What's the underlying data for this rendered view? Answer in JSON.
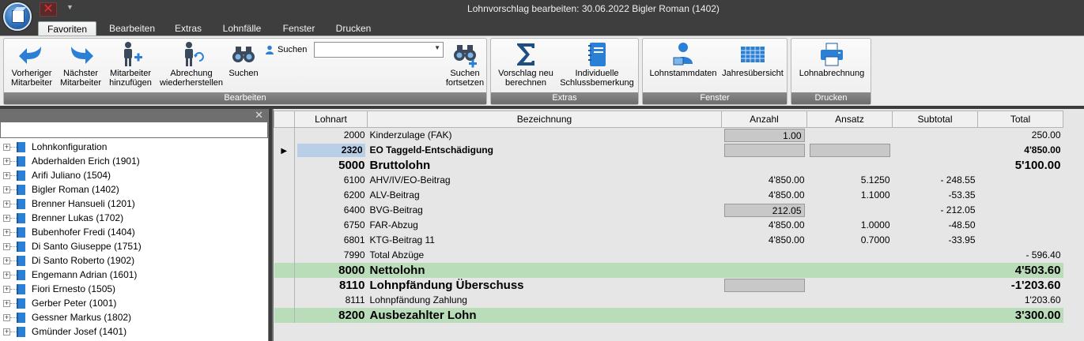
{
  "window": {
    "title": "Lohnvorschlag bearbeiten: 30.06.2022 Bigler Roman (1402)"
  },
  "quick_access": {
    "close_glyph": "✕",
    "dropdown_glyph": "▼"
  },
  "tabs": [
    {
      "label": "Favoriten",
      "active": true
    },
    {
      "label": "Bearbeiten",
      "active": false
    },
    {
      "label": "Extras",
      "active": false
    },
    {
      "label": "Lohnfälle",
      "active": false
    },
    {
      "label": "Fenster",
      "active": false
    },
    {
      "label": "Drucken",
      "active": false
    }
  ],
  "ribbon": {
    "groups": {
      "bearbeiten": {
        "label": "Bearbeiten",
        "buttons": {
          "prev": {
            "line1": "Vorheriger",
            "line2": "Mitarbeiter"
          },
          "next": {
            "line1": "Nächster",
            "line2": "Mitarbeiter"
          },
          "add": {
            "line1": "Mitarbeiter",
            "line2": "hinzufügen"
          },
          "restore": {
            "line1": "Abrechung",
            "line2": "wiederherstellen"
          },
          "search": {
            "line1": "Suchen",
            "line2": ""
          },
          "continue": {
            "line1": "Suchen",
            "line2": "fortsetzen"
          }
        },
        "search_label": "Suchen",
        "search_value": ""
      },
      "extras": {
        "label": "Extras",
        "buttons": {
          "recalc": {
            "line1": "Vorschlag neu",
            "line2": "berechnen"
          },
          "remark": {
            "line1": "Individuelle",
            "line2": "Schlussbemerkung"
          }
        }
      },
      "fenster": {
        "label": "Fenster",
        "buttons": {
          "master": {
            "line1": "Lohnstammdaten",
            "line2": ""
          },
          "yearly": {
            "line1": "Jahresübersicht",
            "line2": ""
          }
        }
      },
      "drucken": {
        "label": "Drucken",
        "buttons": {
          "payslip": {
            "line1": "Lohnabrechnung",
            "line2": ""
          }
        }
      }
    }
  },
  "colors": {
    "accent_blue": "#2b80d6",
    "green_row": "#b9ddb9",
    "selected_cell": "#b9cfe8"
  },
  "left_panel": {
    "close_glyph": "✕",
    "filter_value": "",
    "items": [
      "Lohnkonfiguration",
      "Abderhalden Erich (1901)",
      "Arifi Juliano (1504)",
      "Bigler Roman (1402)",
      "Brenner Hansueli (1201)",
      "Brenner Lukas (1702)",
      "Bubenhofer Fredi (1404)",
      "Di Santo Giuseppe (1751)",
      "Di Santo Roberto (1902)",
      "Engemann Adrian (1601)",
      "Fiori Ernesto (1505)",
      "Gerber Peter (1001)",
      "Gessner Markus (1802)",
      "Gmünder Josef (1401)"
    ]
  },
  "grid": {
    "columns": [
      "Lohnart",
      "Bezeichnung",
      "Anzahl",
      "Ansatz",
      "Subtotal",
      "Total"
    ],
    "current_row_marker": "▶",
    "rows": [
      {
        "lohnart": "2000",
        "bezeichnung": "Kinderzulage (FAK)",
        "anzahl": "1.00",
        "ansatz": "",
        "subtotal": "",
        "total": "250.00",
        "style": "normal",
        "anzahl_box": true,
        "ansatz_box": false
      },
      {
        "lohnart": "2320",
        "bezeichnung": "EO Taggeld-Entschädigung",
        "anzahl": "",
        "ansatz": "",
        "subtotal": "",
        "total": "4'850.00",
        "style": "bold",
        "anzahl_box": true,
        "ansatz_box": true,
        "current": true
      },
      {
        "lohnart": "5000",
        "bezeichnung": "Bruttolohn",
        "anzahl": "",
        "ansatz": "",
        "subtotal": "",
        "total": "5'100.00",
        "style": "big"
      },
      {
        "lohnart": "6100",
        "bezeichnung": "AHV/IV/EO-Beitrag",
        "anzahl": "4'850.00",
        "ansatz": "5.1250",
        "subtotal": "- 248.55",
        "total": "",
        "style": "normal"
      },
      {
        "lohnart": "6200",
        "bezeichnung": "ALV-Beitrag",
        "anzahl": "4'850.00",
        "ansatz": "1.1000",
        "subtotal": "-53.35",
        "total": "",
        "style": "normal"
      },
      {
        "lohnart": "6400",
        "bezeichnung": "BVG-Beitrag",
        "anzahl": "212.05",
        "ansatz": "",
        "subtotal": "- 212.05",
        "total": "",
        "style": "normal",
        "anzahl_box": true
      },
      {
        "lohnart": "6750",
        "bezeichnung": "FAR-Abzug",
        "anzahl": "4'850.00",
        "ansatz": "1.0000",
        "subtotal": "-48.50",
        "total": "",
        "style": "normal"
      },
      {
        "lohnart": "6801",
        "bezeichnung": "KTG-Beitrag 11",
        "anzahl": "4'850.00",
        "ansatz": "0.7000",
        "subtotal": "-33.95",
        "total": "",
        "style": "normal"
      },
      {
        "lohnart": "7990",
        "bezeichnung": "Total Abzüge",
        "anzahl": "",
        "ansatz": "",
        "subtotal": "",
        "total": "- 596.40",
        "style": "normal"
      },
      {
        "lohnart": "8000",
        "bezeichnung": "Nettolohn",
        "anzahl": "",
        "ansatz": "",
        "subtotal": "",
        "total": "4'503.60",
        "style": "big-green"
      },
      {
        "lohnart": "8110",
        "bezeichnung": "Lohnpfändung Überschuss",
        "anzahl": "",
        "ansatz": "",
        "subtotal": "",
        "total": "-1'203.60",
        "style": "bold-big",
        "anzahl_box": true
      },
      {
        "lohnart": "8111",
        "bezeichnung": "Lohnpfändung Zahlung",
        "anzahl": "",
        "ansatz": "",
        "subtotal": "",
        "total": "1'203.60",
        "style": "normal"
      },
      {
        "lohnart": "8200",
        "bezeichnung": "Ausbezahlter Lohn",
        "anzahl": "",
        "ansatz": "",
        "subtotal": "",
        "total": "3'300.00",
        "style": "big-green"
      }
    ]
  }
}
